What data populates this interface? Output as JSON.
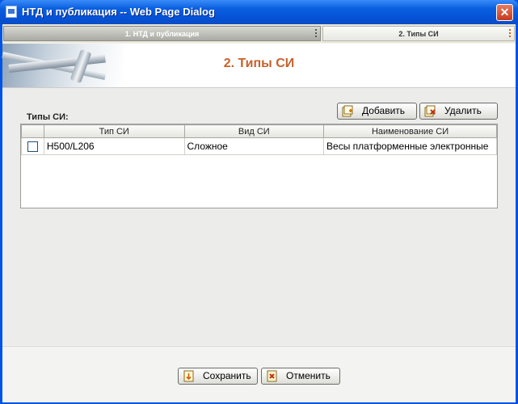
{
  "window": {
    "title": "НТД и публикация -- Web Page Dialog",
    "close": "✕"
  },
  "tabs": [
    {
      "label": "1. НТД и публикация"
    },
    {
      "label": "2. Типы СИ"
    }
  ],
  "page": {
    "heading": "2. Типы СИ",
    "section_label": "Типы СИ:"
  },
  "toolbar": {
    "add_label": "Добавить",
    "delete_label": "Удалить"
  },
  "table": {
    "columns": [
      "Тип СИ",
      "Вид СИ",
      "Наименование СИ"
    ],
    "rows": [
      {
        "checked": false,
        "type": "Н500/L206",
        "kind": "Сложное",
        "name": "Весы платформенные электронные"
      }
    ]
  },
  "footer": {
    "save_label": "Сохранить",
    "cancel_label": "Отменить"
  },
  "colors": {
    "heading": "#c5622d",
    "titlebar": "#0054e3",
    "active_tab": "#a9a9a4"
  },
  "icons": {
    "add": "add-icon",
    "delete": "delete-icon",
    "save": "save-icon",
    "cancel": "cancel-icon"
  }
}
